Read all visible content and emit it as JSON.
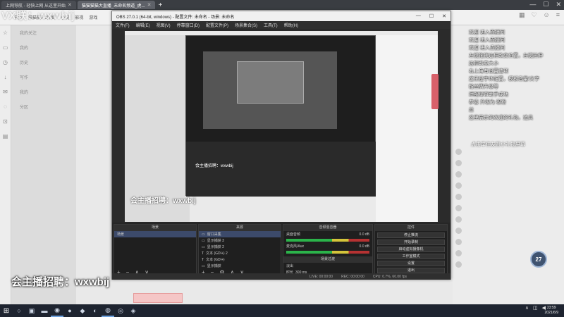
{
  "watermark": "VX联：wxwbij",
  "browser": {
    "tabs": [
      {
        "label": "上网导航 - 轻快上网 从这里开始",
        "active": false
      },
      {
        "label": "猫猫猫猫大直播_未命名频道_虎...",
        "active": true
      }
    ],
    "new_tab": "+",
    "bookmarks": [
      "书签",
      "猫猫猫PC界面",
      "小说",
      "影视",
      "游戏"
    ]
  },
  "obs": {
    "title": "OBS 27.0.1 (64-bit, windows) - 配置文件: 未命名 - 场景: 未命名",
    "menu": [
      "文件(F)",
      "编辑(E)",
      "视图(V)",
      "停靠窗口(D)",
      "配置文件(P)",
      "场景集合(S)",
      "工具(T)",
      "帮助(H)"
    ],
    "docks": {
      "scenes": {
        "title": "场景",
        "items": [
          "场景"
        ]
      },
      "sources": {
        "title": "来源",
        "items": [
          "窗口采集",
          "显示捕获 3",
          "显示捕获 2",
          "文本 (GDI+) 2",
          "文本 (GDI+)",
          "显示捕获"
        ]
      },
      "mixer": {
        "title": "音频混音器",
        "items": [
          "桌面音频",
          "麦克风/Aux"
        ],
        "levels": [
          "0.0 dB",
          "0.0 dB"
        ]
      },
      "transitions": {
        "title": "场景过渡",
        "type": "淡出",
        "duration_label": "时长",
        "duration": "300 ms"
      },
      "controls": {
        "title": "控件",
        "buttons": [
          "停止推流",
          "开始录制",
          "启动虚拟摄像机",
          "工作室模式",
          "设置",
          "退出"
        ]
      }
    },
    "statusbar": [
      "LIVE: 00:00:00",
      "REC: 00:00:00",
      "CPU: 0.7%, 60.00 fps"
    ],
    "nested_recruit": "会主播招聘：wxwbij",
    "nested_small": "会主播招聘：wxwbij"
  },
  "recruit_text": "会主播招聘：wxwbij",
  "overlay_messages": [
    "欢迎 进入直播间",
    "欢迎 进入直播间",
    "欢迎 进入直播间",
    "左键拖拽边框改变位置，左键拉伸",
    "边框改变大小",
    "右上角有设置选项",
    "这里是字体配置，模板音量/文字",
    "粉丝牌升级等",
    "适配绿幕助手成功",
    "恭喜 升级为 级粉",
    "丝",
    "这里展示的欢迎的礼物，追具"
  ],
  "task_hint": "点击举住友盟小礼物屏幕",
  "side_items": [
    "我的关注",
    "我的",
    "历史",
    "写作",
    "我的",
    "分区"
  ],
  "badge_count": "27",
  "taskbar": {
    "clock_time": "23:59",
    "clock_date": "2021/6/9"
  }
}
